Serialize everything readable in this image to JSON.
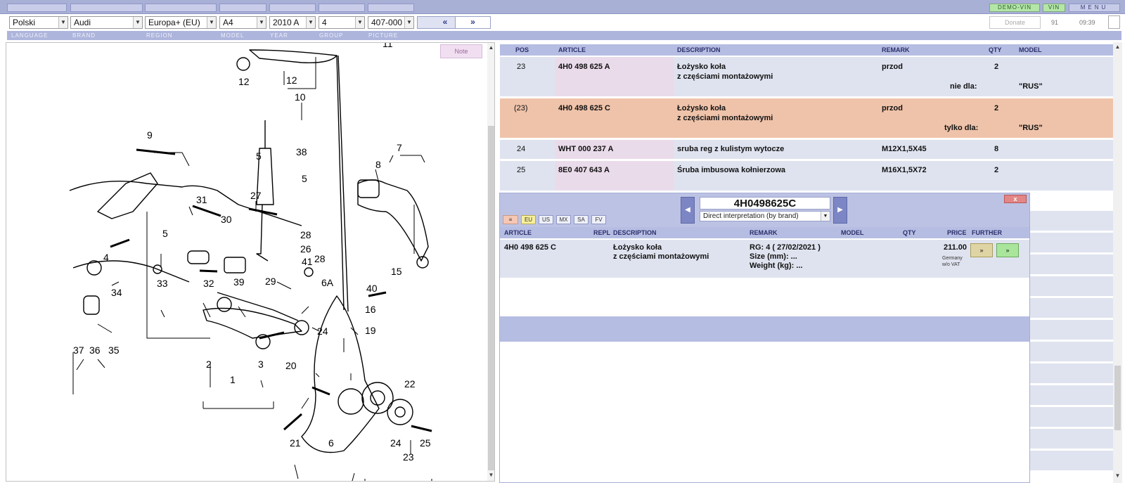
{
  "topbar": {
    "demo_vin_label": "DEMO-VIN",
    "vin_label": "VIN",
    "menu_label": "MENU"
  },
  "selectors": {
    "language": "Polski",
    "brand": "Audi",
    "region": "Europa+ (EU)",
    "model": "A4",
    "year": "2010  A",
    "group": "4",
    "picture": "407-000",
    "prev_label": "«",
    "next_label": "»",
    "donate_label": "Donate",
    "count": "91",
    "time": "09:39"
  },
  "labels": {
    "language": "LANGUAGE",
    "brand": "BRAND",
    "region": "REGION",
    "model": "MODEL",
    "year": "YEAR",
    "group": "GROUP",
    "picture": "PICTURE"
  },
  "diagram": {
    "note_label": "Note",
    "callouts": [
      "9",
      "5",
      "8",
      "7",
      "11",
      "12",
      "12",
      "10",
      "38",
      "31",
      "27",
      "5",
      "30",
      "28",
      "26",
      "5",
      "4",
      "33",
      "32",
      "39",
      "41",
      "28",
      "29",
      "6A",
      "40",
      "15",
      "34",
      "16",
      "19",
      "24",
      "37",
      "36",
      "35",
      "2",
      "3",
      "1",
      "20",
      "22",
      "21",
      "6",
      "24",
      "25",
      "23"
    ],
    "highlighted_callout": "23"
  },
  "parts_table": {
    "headers": {
      "pos": "POS",
      "article": "ARTICLE",
      "description": "DESCRIPTION",
      "remark": "REMARK",
      "qty": "QTY",
      "model": "MODEL"
    },
    "rows": [
      {
        "pos": "23",
        "article": "4H0 498 625 A",
        "desc1": "Łożysko koła",
        "desc2": "z częściami montażowymi",
        "remark": "przod",
        "qty": "2",
        "cond": "nie dla:",
        "model": "\"RUS\"",
        "highlight": false
      },
      {
        "pos": "(23)",
        "article": "4H0 498 625 C",
        "desc1": "Łożysko koła",
        "desc2": "z częściami montażowymi",
        "remark": "przod",
        "qty": "2",
        "cond": "tylko dla:",
        "model": "\"RUS\"",
        "highlight": true
      },
      {
        "pos": "24",
        "article": "WHT 000 237 A",
        "desc1": "sruba reg z kulistym wytocze",
        "desc2": "",
        "remark": "M12X1,5X45",
        "qty": "8",
        "cond": "",
        "model": "",
        "highlight": false
      },
      {
        "pos": "25",
        "article": "8E0 407 643 A",
        "desc1": "Śruba imbusowa kołnierzowa",
        "desc2": "",
        "remark": "M16X1,5X72",
        "qty": "2",
        "cond": "",
        "model": "",
        "highlight": false
      }
    ]
  },
  "popup": {
    "close_label": "x",
    "part_number": "4H0498625C",
    "interpretation": "Direct interpretation (by brand)",
    "region_buttons": [
      "≡",
      "EU",
      "US",
      "MX",
      "SA",
      "FV"
    ],
    "active_region": "EU",
    "headers": {
      "article": "ARTICLE",
      "repl": "REPL",
      "description": "DESCRIPTION",
      "remark": "REMARK",
      "model": "MODEL",
      "qty": "QTY",
      "price": "PRICE",
      "further": "FURTHER"
    },
    "result": {
      "article": "4H0 498 625 C",
      "desc1": "Łożysko koła",
      "desc2": "z częściami montażowymi",
      "remark1": "RG: 4 ( 27/02/2021 )",
      "remark2": "Size (mm): ...",
      "remark3": "Weight (kg): ...",
      "price": "211.00",
      "price_note1": "Germany",
      "price_note2": "w/o VAT",
      "further1": "»",
      "further2": "»"
    }
  }
}
